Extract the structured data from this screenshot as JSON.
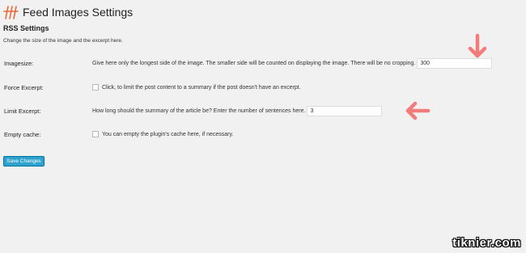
{
  "header": {
    "title": "Feed Images Settings",
    "icon": "feed-images-logo-icon",
    "icon_color": "#e86a3a"
  },
  "section": {
    "title": "RSS Settings",
    "description": "Change the size of the image and the excerpt here."
  },
  "fields": {
    "imagesize": {
      "label": "Imagesize:",
      "description": "Give here only the longest side of the image. The smaller side will be counted on displaying the image. There will be no cropping.",
      "value": "300"
    },
    "force_excerpt": {
      "label": "Force Excerpt:",
      "checkbox_label": "Click, to limit the post content to a summary if the post doesn't have an excerpt.",
      "checked": false
    },
    "limit_excerpt": {
      "label": "Limit Excerpt:",
      "description": "How long should the summary of the article be? Enter the number of sentences here.",
      "value": "3"
    },
    "empty_cache": {
      "label": "Empty cache:",
      "checkbox_label": "You can empty the plugin's cache here, if necessary.",
      "checked": false
    }
  },
  "actions": {
    "save_label": "Save Changes",
    "save_color": "#2ea2cc"
  },
  "annotations": {
    "arrow_color": "#f27c7c",
    "arrow_down_icon": "arrow-down-icon",
    "arrow_left_icon": "arrow-left-icon"
  },
  "watermark": "tiknier.com"
}
